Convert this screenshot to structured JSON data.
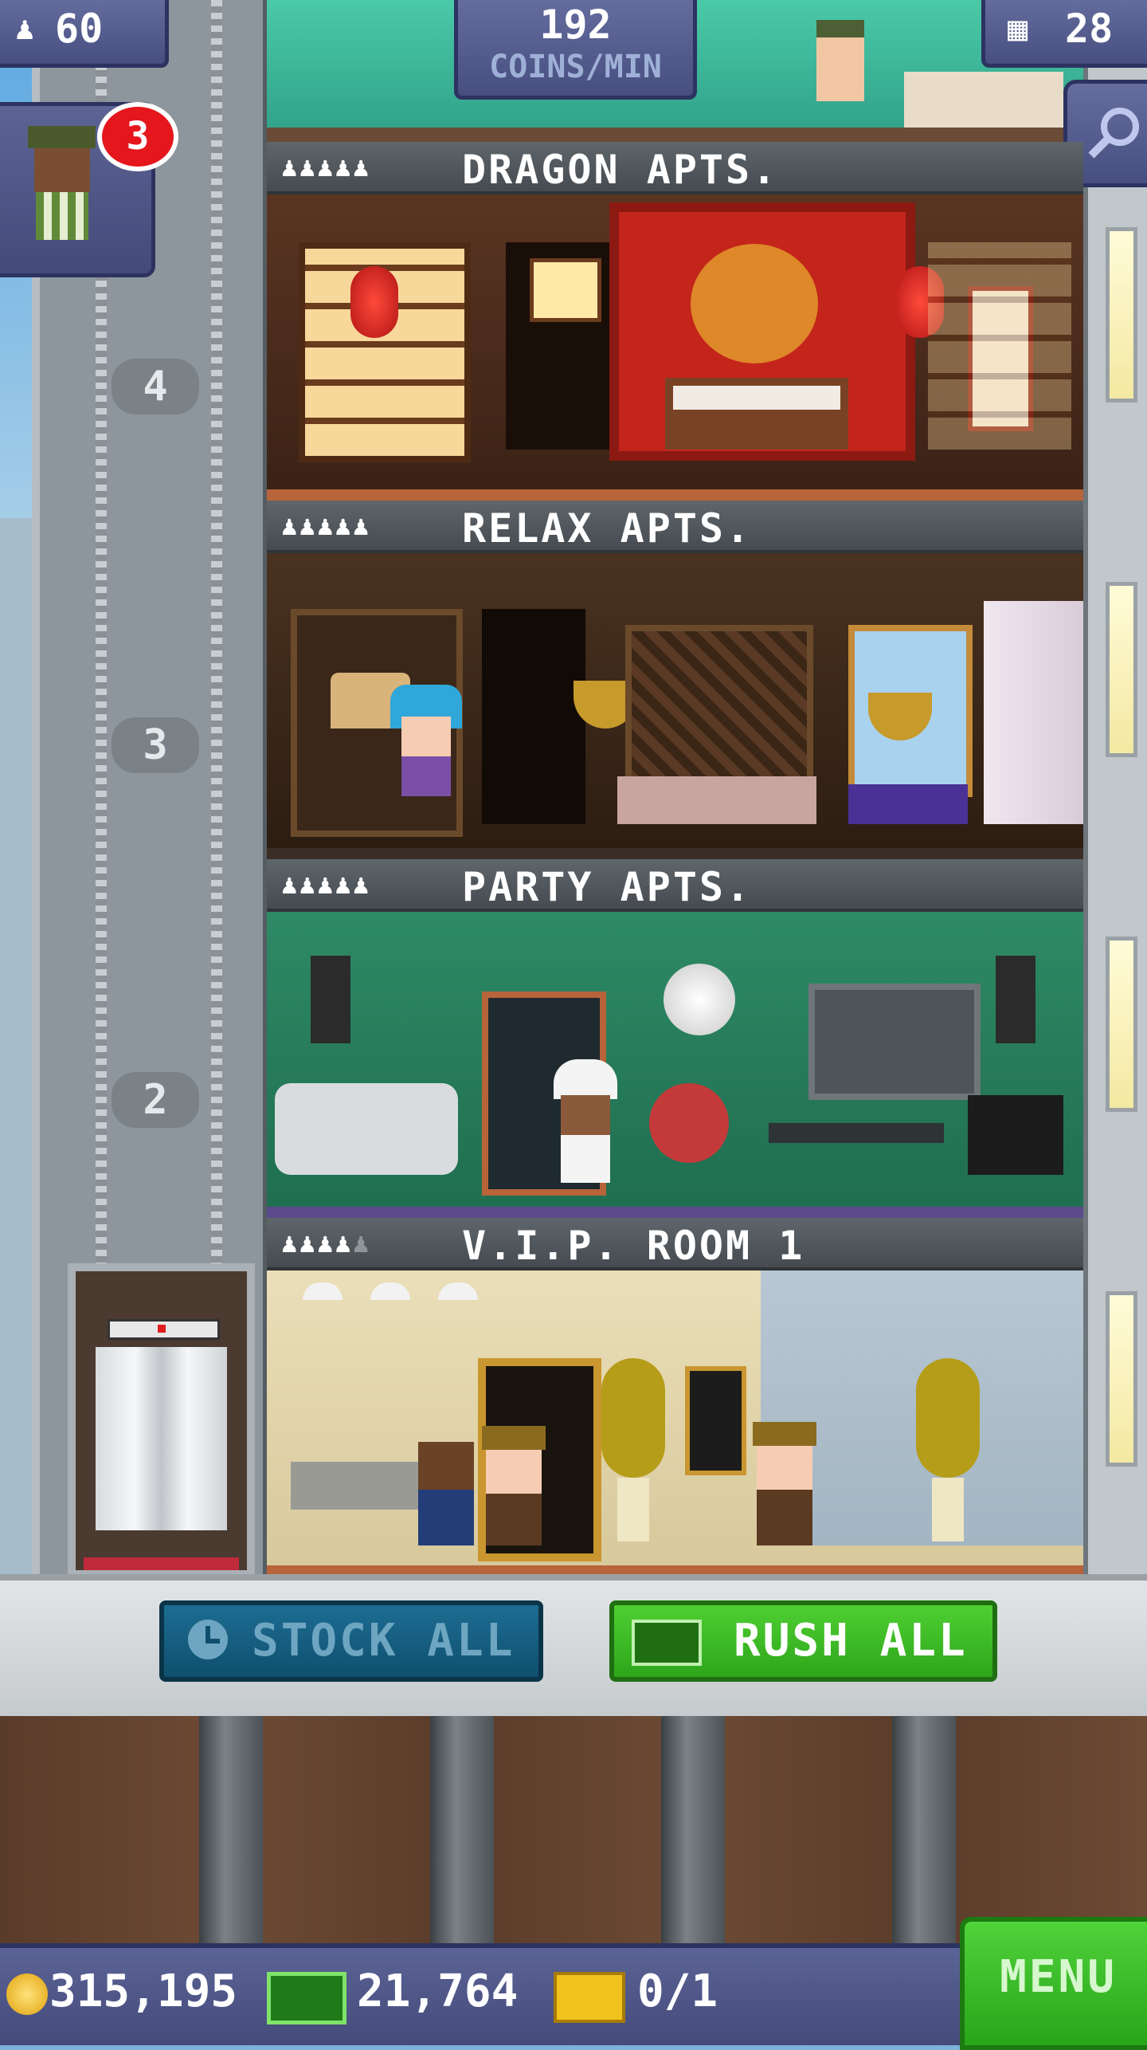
{
  "hud": {
    "population": "60",
    "coins_per_min_value": "192",
    "coins_per_min_label": "COINS/MIN",
    "floors": "28",
    "notification_count": "3"
  },
  "floors": [
    {
      "name": "DRAGON APTS.",
      "stars_filled": 5,
      "stars_total": 5,
      "number": "4"
    },
    {
      "name": "RELAX APTS.",
      "stars_filled": 5,
      "stars_total": 5,
      "number": "3"
    },
    {
      "name": "PARTY APTS.",
      "stars_filled": 5,
      "stars_total": 5,
      "number": "2"
    },
    {
      "name": "V.I.P. ROOM 1",
      "stars_filled": 4,
      "stars_total": 5,
      "number": ""
    }
  ],
  "buttons": {
    "stock_all": "STOCK ALL",
    "rush_all": "RUSH ALL",
    "menu": "MENU"
  },
  "currency": {
    "coins": "315,195",
    "bux": "21,764",
    "tickets": "0/1"
  },
  "colors": {
    "accent_green": "#3cc226",
    "stock_blue": "#155f82",
    "hud_purple": "#555c8e",
    "badge_red": "#e5161c"
  },
  "icons": [
    "person-icon",
    "building-icon",
    "search-icon",
    "clock-icon",
    "bux-icon",
    "coin-icon",
    "ticket-icon"
  ]
}
